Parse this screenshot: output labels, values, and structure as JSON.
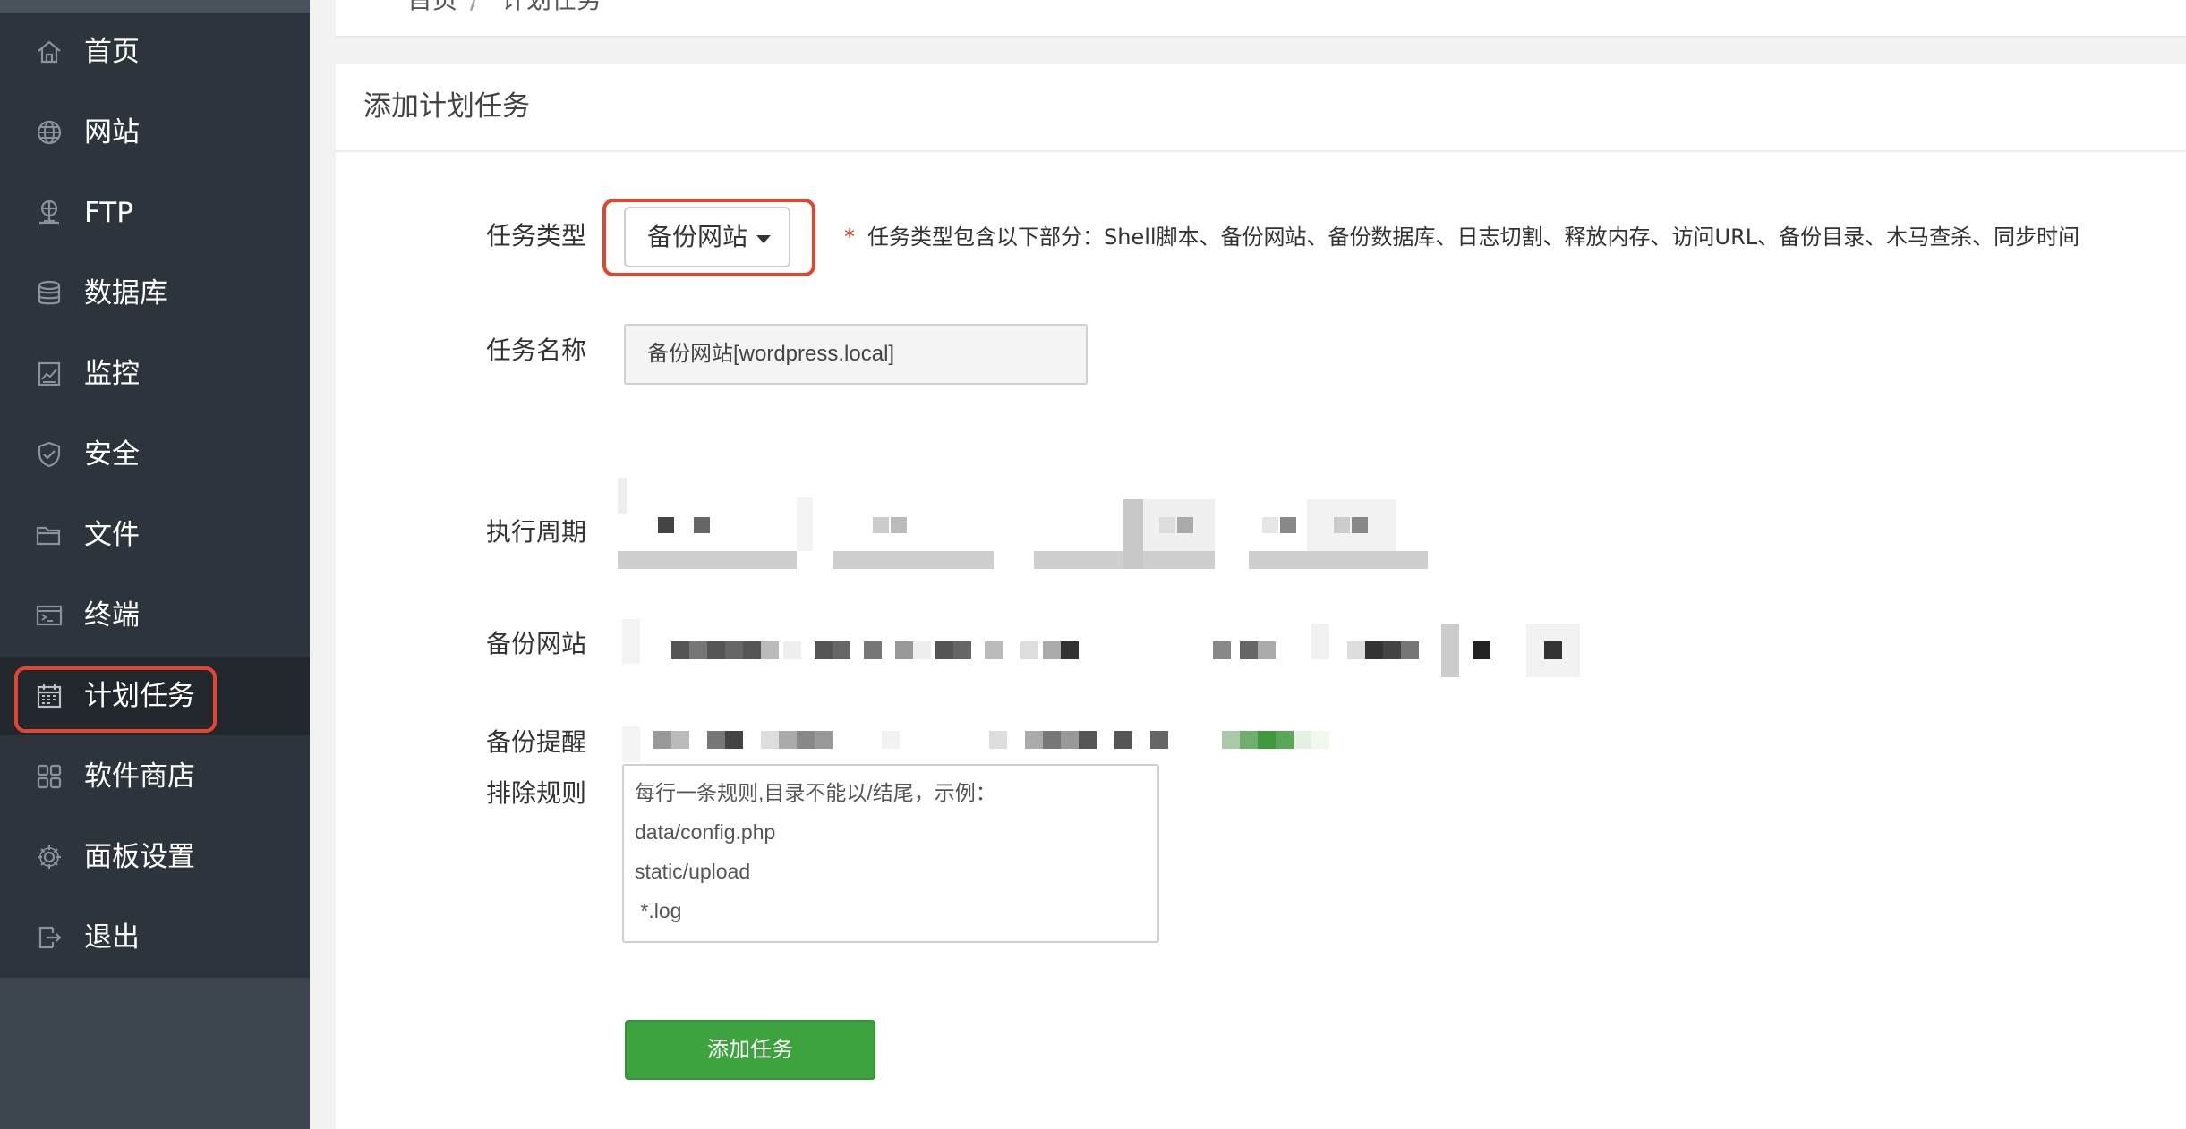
{
  "sidebar": {
    "items": [
      {
        "label": "首页",
        "icon": "home-icon"
      },
      {
        "label": "网站",
        "icon": "globe-icon"
      },
      {
        "label": "FTP",
        "icon": "ftp-icon"
      },
      {
        "label": "数据库",
        "icon": "database-icon"
      },
      {
        "label": "监控",
        "icon": "monitor-icon"
      },
      {
        "label": "安全",
        "icon": "shield-icon"
      },
      {
        "label": "文件",
        "icon": "folder-icon"
      },
      {
        "label": "终端",
        "icon": "terminal-icon"
      },
      {
        "label": "计划任务",
        "icon": "calendar-icon",
        "active": true
      },
      {
        "label": "软件商店",
        "icon": "apps-icon"
      },
      {
        "label": "面板设置",
        "icon": "gear-icon"
      },
      {
        "label": "退出",
        "icon": "logout-icon"
      }
    ]
  },
  "breadcrumb": {
    "home": "首页",
    "separator": "/",
    "current": "计划任务"
  },
  "panel": {
    "title": "添加计划任务"
  },
  "form": {
    "task_type_label": "任务类型",
    "task_type_value": "备份网站",
    "task_type_hint_star": "*",
    "task_type_hint": "任务类型包含以下部分：Shell脚本、备份网站、备份数据库、日志切割、释放内存、访问URL、备份目录、木马查杀、同步时间",
    "task_name_label": "任务名称",
    "task_name_value": "备份网站[wordpress.local]",
    "cycle_label": "执行周期",
    "backup_site_label": "备份网站",
    "backup_notify_label": "备份提醒",
    "exclude_label": "排除规则",
    "exclude_lines": [
      "每行一条规则,目录不能以/结尾，示例：",
      "data/config.php",
      "static/upload",
      " *.log"
    ],
    "submit_label": "添加任务"
  },
  "colors": {
    "sidebar_bg": "#2e343b",
    "sidebar_active_bg": "#22272d",
    "highlight_red": "#e4452e",
    "primary_green": "#3ca33f"
  }
}
